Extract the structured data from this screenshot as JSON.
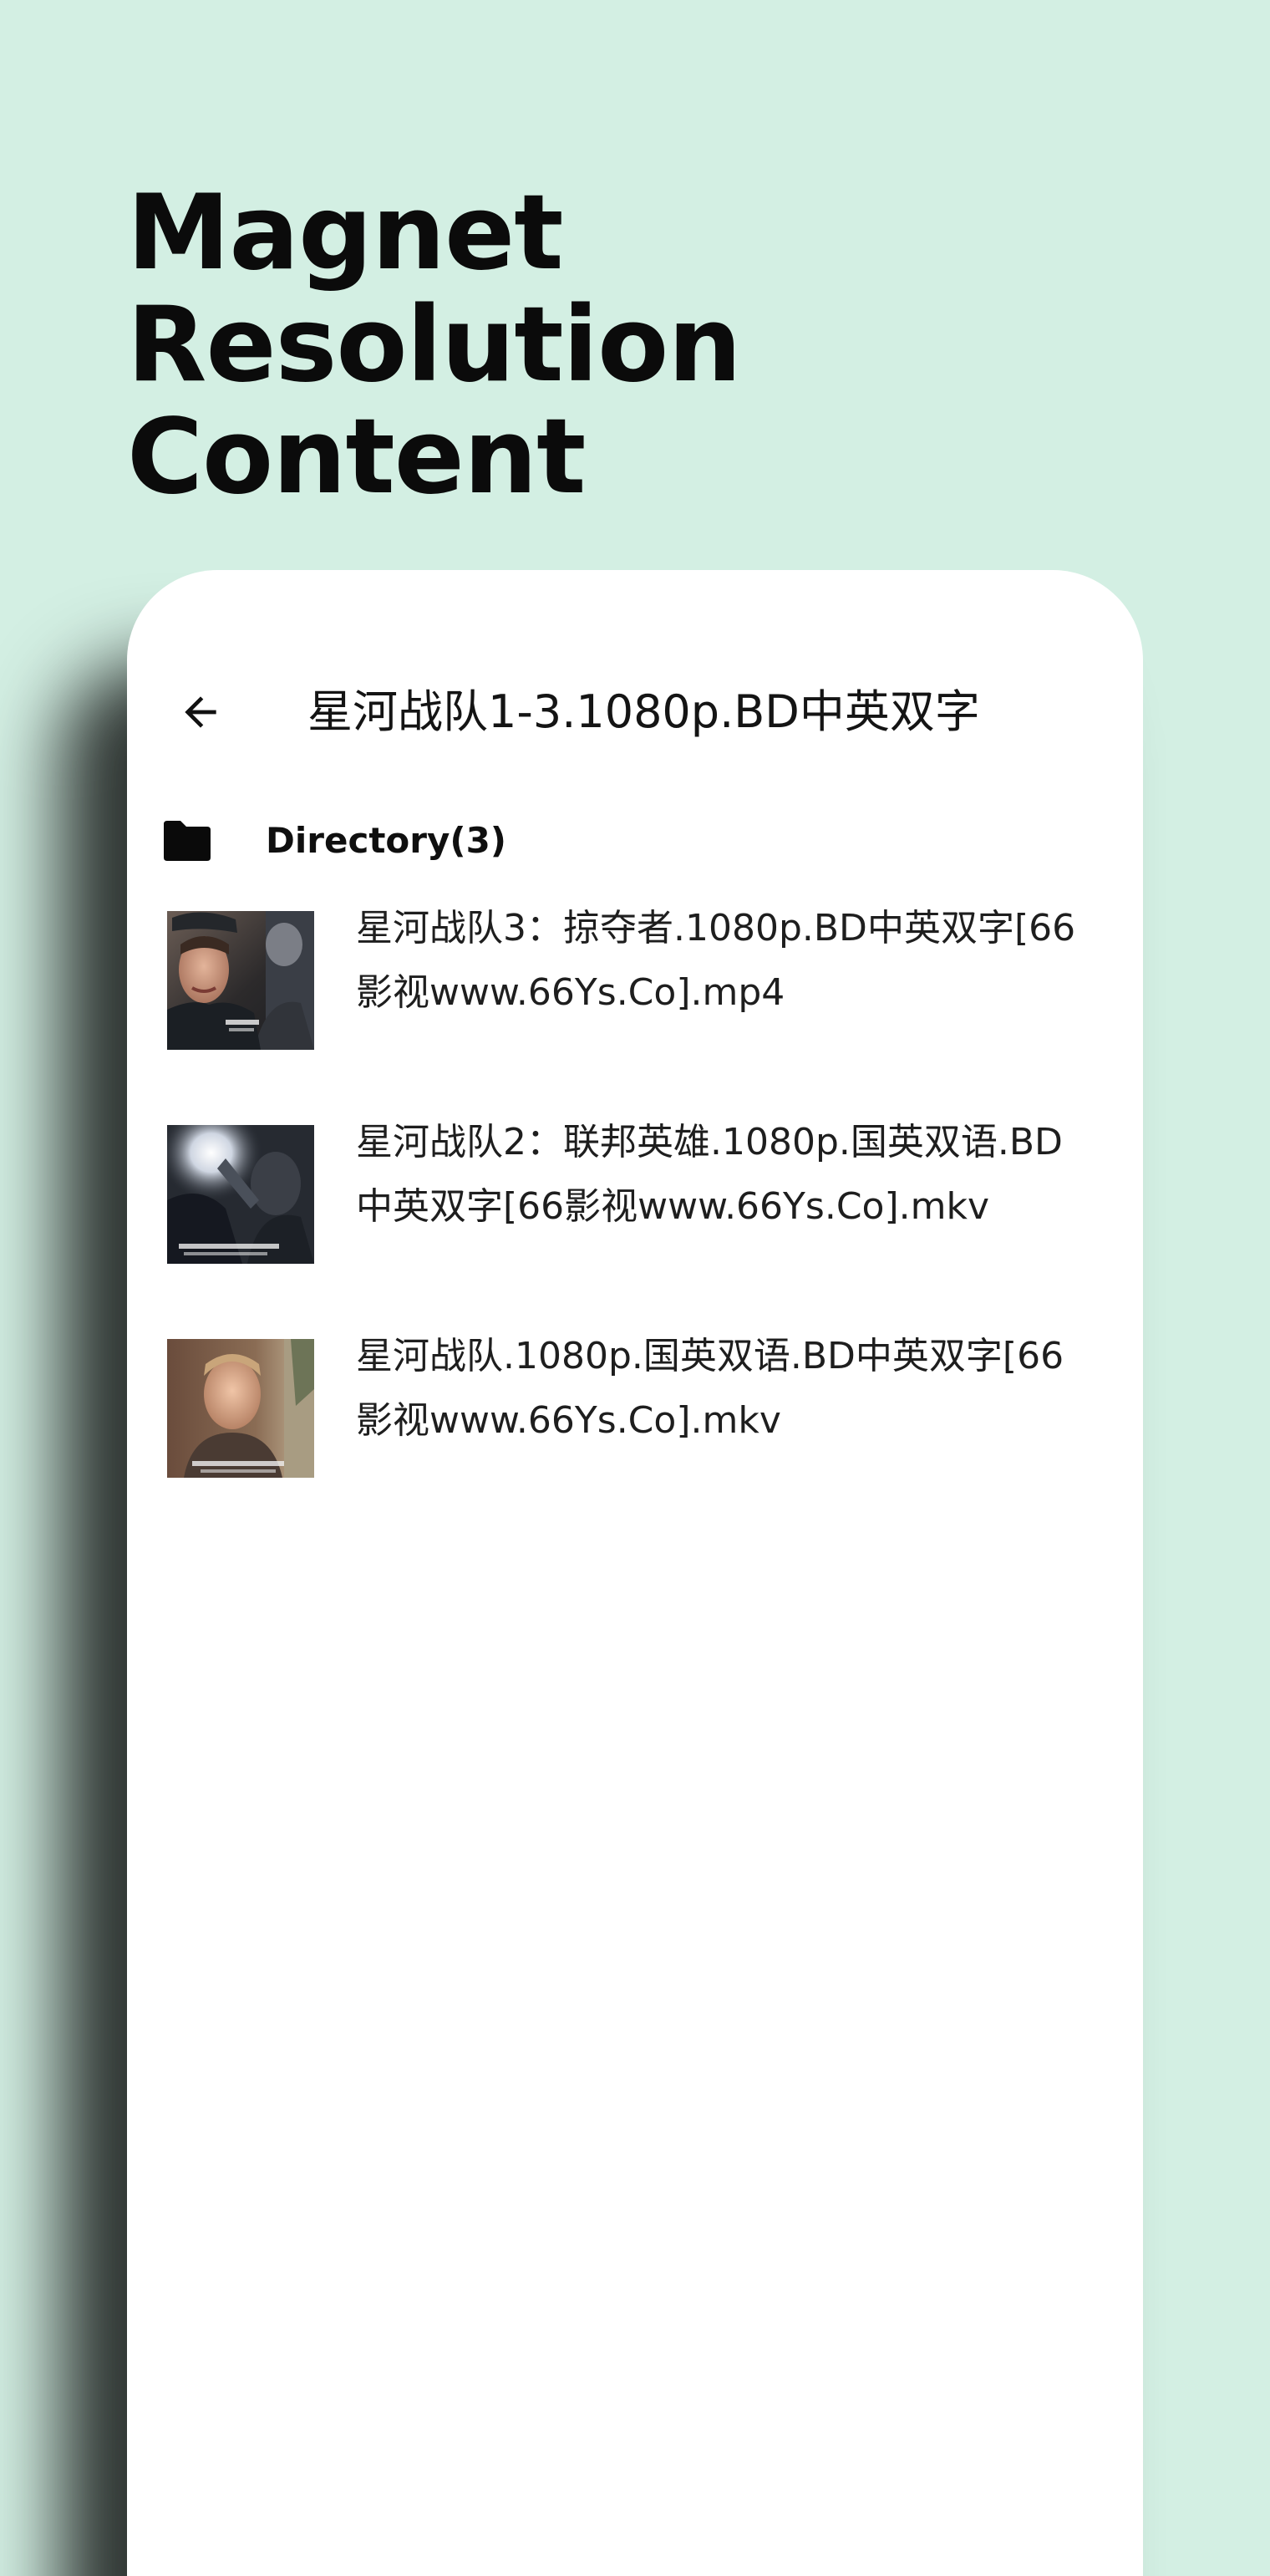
{
  "headline": {
    "line1": "Magnet Resolution",
    "line2": "Content"
  },
  "appbar": {
    "back_icon": "arrow-left-icon",
    "title": "星河战队1-3.1080p.BD中英双字"
  },
  "directory": {
    "icon": "folder-icon",
    "label": "Directory(3)"
  },
  "files": [
    {
      "name": "星河战队3：掠夺者.1080p.BD中英双字[66影视www.66Ys.Co].mp4"
    },
    {
      "name": "星河战队2：联邦英雄.1080p.国英双语.BD中英双字[66影视www.66Ys.Co].mkv"
    },
    {
      "name": "星河战队.1080p.国英双语.BD中英双字[66影视www.66Ys.Co].mkv"
    }
  ],
  "colors": {
    "background": "#d3efe3",
    "card": "#ffffff",
    "text": "#141414"
  }
}
